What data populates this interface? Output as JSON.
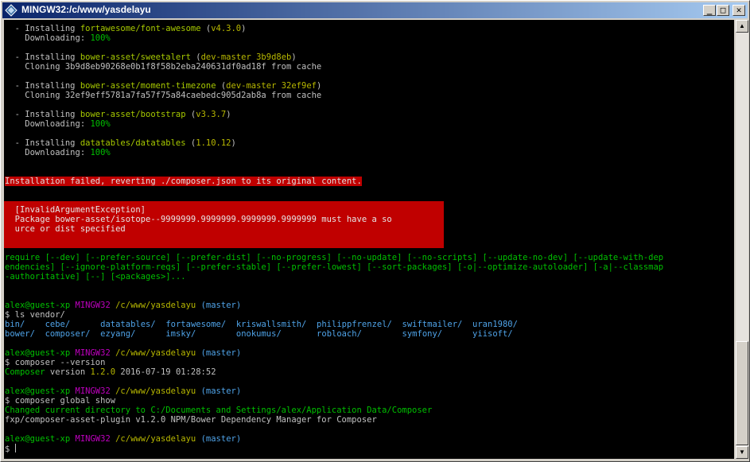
{
  "window": {
    "title": "MINGW32:/c/www/yasdelayu",
    "btn_min": "_",
    "btn_max": "□",
    "btn_close": "✕"
  },
  "scrollbar": {
    "up": "▲",
    "down": "▼"
  },
  "colors": {
    "titlebar_start": "#0a246a",
    "titlebar_end": "#a6caf0",
    "terminal_bg": "#000000",
    "error_bg": "#c00000",
    "package_green": "#a7c900",
    "version_yellow": "#b8b800",
    "prompt_green": "#00c000",
    "prompt_magenta": "#c000c0",
    "path_blue": "#4fa3e8"
  },
  "lines": [
    {
      "segs": [
        {
          "t": "  - Installing "
        },
        {
          "t": "fortawesome/font-awesome",
          "c": "cy"
        },
        {
          "t": " ("
        },
        {
          "t": "v4.3.0",
          "c": "yw"
        },
        {
          "t": ")"
        }
      ]
    },
    {
      "segs": [
        {
          "t": "    Downloading: "
        },
        {
          "t": "100%",
          "c": "gr"
        }
      ]
    },
    {
      "segs": []
    },
    {
      "segs": [
        {
          "t": "  - Installing "
        },
        {
          "t": "bower-asset/sweetalert",
          "c": "cy"
        },
        {
          "t": " ("
        },
        {
          "t": "dev-master 3b9d8eb",
          "c": "yw"
        },
        {
          "t": ")"
        }
      ]
    },
    {
      "segs": [
        {
          "t": "    Cloning 3b9d8eb90268e0b1f8f58b2eba240631df0ad18f from cache"
        }
      ]
    },
    {
      "segs": []
    },
    {
      "segs": [
        {
          "t": "  - Installing "
        },
        {
          "t": "bower-asset/moment-timezone",
          "c": "cy"
        },
        {
          "t": " ("
        },
        {
          "t": "dev-master 32ef9ef",
          "c": "yw"
        },
        {
          "t": ")"
        }
      ]
    },
    {
      "segs": [
        {
          "t": "    Cloning 32ef9eff5781a7fa57f75a84caebedc905d2ab8a from cache"
        }
      ]
    },
    {
      "segs": []
    },
    {
      "segs": [
        {
          "t": "  - Installing "
        },
        {
          "t": "bower-asset/bootstrap",
          "c": "cy"
        },
        {
          "t": " ("
        },
        {
          "t": "v3.3.7",
          "c": "yw"
        },
        {
          "t": ")"
        }
      ]
    },
    {
      "segs": [
        {
          "t": "    Downloading: "
        },
        {
          "t": "100%",
          "c": "gr"
        }
      ]
    },
    {
      "segs": []
    },
    {
      "segs": [
        {
          "t": "  - Installing "
        },
        {
          "t": "datatables/datatables",
          "c": "cy"
        },
        {
          "t": " ("
        },
        {
          "t": "1.10.12",
          "c": "yw"
        },
        {
          "t": ")"
        }
      ]
    },
    {
      "segs": [
        {
          "t": "    Downloading: "
        },
        {
          "t": "100%",
          "c": "gr"
        }
      ]
    },
    {
      "segs": []
    },
    {
      "segs": []
    },
    {
      "segs": [
        {
          "t": "Installation failed, reverting ./composer.json to its original content.",
          "c": "hl"
        }
      ]
    },
    {
      "segs": []
    },
    {
      "segs": []
    },
    {
      "segs": [
        {
          "t": "  [InvalidArgumentException]",
          "c": "errtxt"
        }
      ]
    },
    {
      "segs": [
        {
          "t": "  Package bower-asset/isotope--9999999.9999999.9999999.9999999 must have a so",
          "c": "errtxt"
        }
      ]
    },
    {
      "segs": [
        {
          "t": "  urce or dist specified",
          "c": "errtxt"
        }
      ]
    },
    {
      "segs": []
    },
    {
      "segs": []
    },
    {
      "segs": [
        {
          "t": "require [--dev] [--prefer-source] [--prefer-dist] [--no-progress] [--no-update] [--no-scripts] [--update-no-dev] [--update-with-dep",
          "c": "gr"
        }
      ]
    },
    {
      "segs": [
        {
          "t": "endencies] [--ignore-platform-reqs] [--prefer-stable] [--prefer-lowest] [--sort-packages] [-o|--optimize-autoloader] [-a|--classmap",
          "c": "gr"
        }
      ]
    },
    {
      "segs": [
        {
          "t": "-authoritative] [--] [<packages>]...",
          "c": "gr"
        }
      ]
    },
    {
      "segs": []
    },
    {
      "segs": []
    },
    {
      "segs": [
        {
          "t": "alex@guest-xp",
          "c": "gr"
        },
        {
          "t": " "
        },
        {
          "t": "MINGW32",
          "c": "mg"
        },
        {
          "t": " "
        },
        {
          "t": "/c/www/yasdelayu",
          "c": "yw"
        },
        {
          "t": " "
        },
        {
          "t": "(master)",
          "c": "bl"
        }
      ]
    },
    {
      "segs": [
        {
          "t": "$ ls vendor/"
        }
      ]
    },
    {
      "segs": [
        {
          "t": "bin/",
          "c": "bl"
        },
        {
          "t": "    "
        },
        {
          "t": "cebe/",
          "c": "bl"
        },
        {
          "t": "      "
        },
        {
          "t": "datatables/",
          "c": "bl"
        },
        {
          "t": "  "
        },
        {
          "t": "fortawesome/",
          "c": "bl"
        },
        {
          "t": "  "
        },
        {
          "t": "kriswallsmith/",
          "c": "bl"
        },
        {
          "t": "  "
        },
        {
          "t": "philippfrenzel/",
          "c": "bl"
        },
        {
          "t": "  "
        },
        {
          "t": "swiftmailer/",
          "c": "bl"
        },
        {
          "t": "  "
        },
        {
          "t": "uran1980/",
          "c": "bl"
        }
      ]
    },
    {
      "segs": [
        {
          "t": "bower/",
          "c": "bl"
        },
        {
          "t": "  "
        },
        {
          "t": "composer/",
          "c": "bl"
        },
        {
          "t": "  "
        },
        {
          "t": "ezyang/",
          "c": "bl"
        },
        {
          "t": "      "
        },
        {
          "t": "imsky/",
          "c": "bl"
        },
        {
          "t": "        "
        },
        {
          "t": "onokumus/",
          "c": "bl"
        },
        {
          "t": "       "
        },
        {
          "t": "robloach/",
          "c": "bl"
        },
        {
          "t": "        "
        },
        {
          "t": "symfony/",
          "c": "bl"
        },
        {
          "t": "      "
        },
        {
          "t": "yiisoft/",
          "c": "bl"
        }
      ]
    },
    {
      "segs": []
    },
    {
      "segs": [
        {
          "t": "alex@guest-xp",
          "c": "gr"
        },
        {
          "t": " "
        },
        {
          "t": "MINGW32",
          "c": "mg"
        },
        {
          "t": " "
        },
        {
          "t": "/c/www/yasdelayu",
          "c": "yw"
        },
        {
          "t": " "
        },
        {
          "t": "(master)",
          "c": "bl"
        }
      ]
    },
    {
      "segs": [
        {
          "t": "$ composer --version"
        }
      ]
    },
    {
      "segs": [
        {
          "t": "Composer",
          "c": "gr"
        },
        {
          "t": " version "
        },
        {
          "t": "1.2.0",
          "c": "yw"
        },
        {
          "t": " 2016-07-19 01:28:52"
        }
      ]
    },
    {
      "segs": []
    },
    {
      "segs": [
        {
          "t": "alex@guest-xp",
          "c": "gr"
        },
        {
          "t": " "
        },
        {
          "t": "MINGW32",
          "c": "mg"
        },
        {
          "t": " "
        },
        {
          "t": "/c/www/yasdelayu",
          "c": "yw"
        },
        {
          "t": " "
        },
        {
          "t": "(master)",
          "c": "bl"
        }
      ]
    },
    {
      "segs": [
        {
          "t": "$ composer global show"
        }
      ]
    },
    {
      "segs": [
        {
          "t": "Changed current directory to C:/Documents and Settings/alex/Application Data/Composer",
          "c": "gr"
        }
      ]
    },
    {
      "segs": [
        {
          "t": "fxp/composer-asset-plugin v1.2.0 NPM/Bower Dependency Manager for Composer"
        }
      ]
    },
    {
      "segs": []
    },
    {
      "segs": [
        {
          "t": "alex@guest-xp",
          "c": "gr"
        },
        {
          "t": " "
        },
        {
          "t": "MINGW32",
          "c": "mg"
        },
        {
          "t": " "
        },
        {
          "t": "/c/www/yasdelayu",
          "c": "yw"
        },
        {
          "t": " "
        },
        {
          "t": "(master)",
          "c": "bl"
        }
      ]
    },
    {
      "segs": [
        {
          "t": "$ "
        }
      ],
      "cursor": true
    }
  ]
}
